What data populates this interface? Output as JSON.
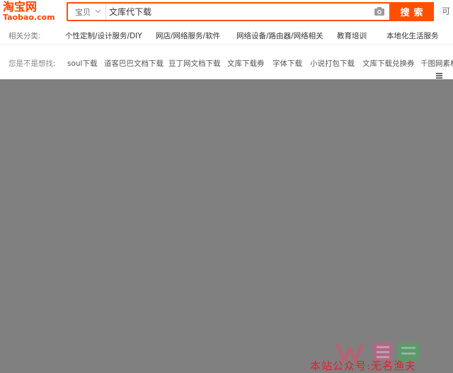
{
  "logo": {
    "cn": "淘宝网",
    "en": "Taobao.com"
  },
  "search": {
    "scope": "宝贝",
    "query": "文库代下载",
    "button": "搜索",
    "button_color": "#ff5000"
  },
  "edge_char": "可",
  "categories": {
    "label": "相关分类:",
    "items": [
      "个性定制/设计服务/DIY",
      "网店/网络服务/软件",
      "网络设备/路由器/网络相关",
      "教育培训",
      "本地化生活服务"
    ]
  },
  "suggestions": {
    "label": "您是不是想找:",
    "items": [
      "soul下载",
      "道客巴巴文档下载",
      "豆丁网文档下载",
      "文库下载券",
      "字体下载",
      "小说打包下载",
      "文库下载兑换券",
      "千图网素材"
    ]
  },
  "watermark": {
    "text": "本站公众号:无名渔夫"
  },
  "colors": {
    "accent": "#ff5000",
    "content_bg": "#808080"
  }
}
